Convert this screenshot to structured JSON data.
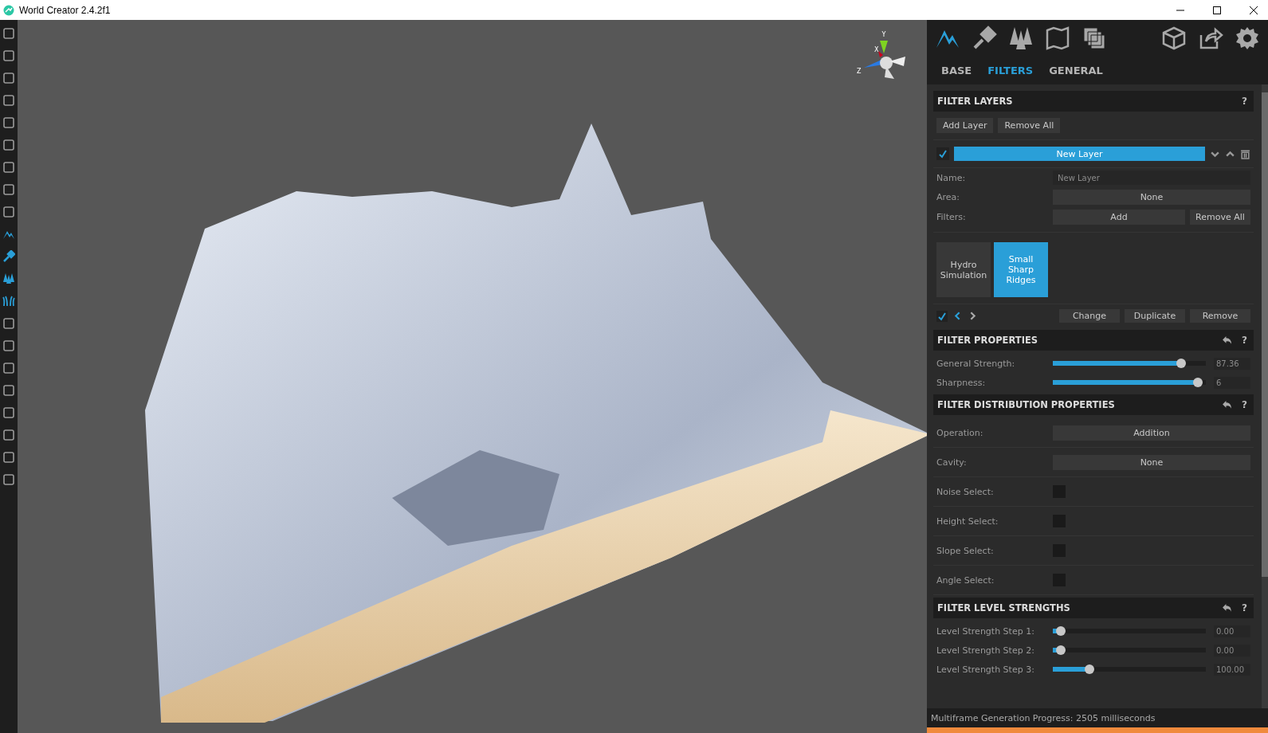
{
  "window": {
    "title": "World Creator 2.4.2f1"
  },
  "left_toolbar": [
    {
      "active": false
    },
    {
      "active": false
    },
    {
      "active": false
    },
    {
      "active": false
    },
    {
      "active": false
    },
    {
      "active": false
    },
    {
      "active": false
    },
    {
      "active": false
    },
    {
      "active": false
    },
    {
      "active": true
    },
    {
      "active": true
    },
    {
      "active": true
    },
    {
      "active": true
    },
    {
      "active": false
    },
    {
      "active": false
    },
    {
      "active": false
    },
    {
      "active": false
    },
    {
      "active": false
    },
    {
      "active": false
    },
    {
      "active": false
    },
    {
      "active": false
    }
  ],
  "viewport": {
    "gizmo": {
      "x_label": "X",
      "y_label": "Y",
      "z_label": "Z"
    }
  },
  "panel_toolbar": [
    {
      "selected": true
    },
    {
      "selected": false
    },
    {
      "selected": false
    },
    {
      "selected": false
    },
    {
      "selected": false
    },
    {
      "selected": false
    },
    {
      "selected": false
    },
    {
      "selected": false
    }
  ],
  "tabs": [
    {
      "label": "BASE",
      "selected": false
    },
    {
      "label": "FILTERS",
      "selected": true
    },
    {
      "label": "GENERAL",
      "selected": false
    }
  ],
  "filter_layers": {
    "title": "FILTER LAYERS",
    "help": "?",
    "buttons": [
      "Add Layer",
      "Remove All"
    ],
    "layer": {
      "checked": true,
      "name": "New Layer",
      "selected": true
    },
    "name_label": "Name:",
    "name_value": "New Layer",
    "area_label": "Area:",
    "area_value": "None",
    "filters_label": "Filters:",
    "filters_add": "Add",
    "filters_remove": "Remove All",
    "filters": [
      {
        "label": "Hydro Simulation",
        "selected": false
      },
      {
        "label": "Small Sharp Ridges",
        "selected": true
      }
    ],
    "filter_checked": true,
    "filter_buttons": [
      "Change",
      "Duplicate",
      "Remove"
    ]
  },
  "filter_properties": {
    "title": "FILTER PROPERTIES",
    "help": "?",
    "sliders": [
      {
        "label": "General Strength:",
        "level": 0.86,
        "reading": "87.36"
      },
      {
        "label": "Sharpness:",
        "level": 0.98,
        "reading": "6"
      }
    ]
  },
  "distribution": {
    "title": "FILTER DISTRIBUTION PROPERTIES",
    "help": "?",
    "rows": [
      {
        "kind": "dropdown",
        "label": "Operation:",
        "value": "Addition"
      },
      {
        "kind": "dropdown",
        "label": "Cavity:",
        "value": "None"
      },
      {
        "kind": "checkbox",
        "label": "Noise Select:",
        "checked": false
      },
      {
        "kind": "checkbox",
        "label": "Height Select:",
        "checked": false
      },
      {
        "kind": "checkbox",
        "label": "Slope Select:",
        "checked": false
      },
      {
        "kind": "checkbox",
        "label": "Angle Select:",
        "checked": false
      }
    ]
  },
  "level_strengths": {
    "title": "FILTER LEVEL STRENGTHS",
    "help": "?",
    "sliders": [
      {
        "label": "Level Strength Step 1:",
        "level": 0.02,
        "reading": "0.00"
      },
      {
        "label": "Level Strength Step 2:",
        "level": 0.02,
        "reading": "0.00"
      },
      {
        "label": "Level Strength Step 3:",
        "level": 0.22,
        "reading": "100.00"
      }
    ]
  },
  "status_bar": {
    "text": "Multiframe Generation Progress: 2505 milliseconds",
    "progress": {
      "level": 1
    }
  }
}
